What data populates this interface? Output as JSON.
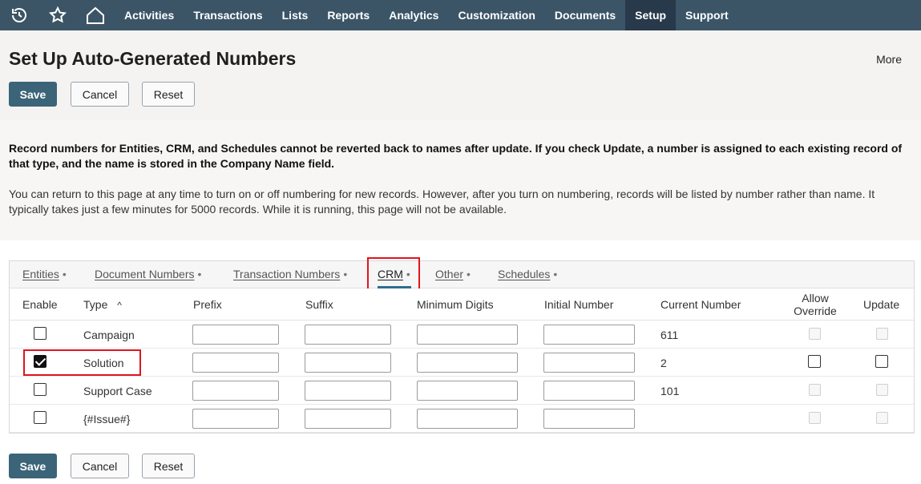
{
  "nav": {
    "icons": [
      "recent-history-icon",
      "star-icon",
      "home-icon"
    ],
    "items": [
      "Activities",
      "Transactions",
      "Lists",
      "Reports",
      "Analytics",
      "Customization",
      "Documents",
      "Setup",
      "Support"
    ],
    "active": "Setup"
  },
  "page": {
    "title": "Set Up Auto-Generated Numbers",
    "more": "More"
  },
  "buttons": {
    "save": "Save",
    "cancel": "Cancel",
    "reset": "Reset"
  },
  "info": {
    "warning": "Record numbers for Entities, CRM, and Schedules cannot be reverted back to names after update. If you check Update, a number is assigned to each existing record of that type, and the name is stored in the Company Name field.",
    "note": "You can return to this page at any time to turn on or off numbering for new records. However, after you turn on numbering, records will be listed by number rather than name. It typically takes just a few minutes for 5000 records. While it is running, this page will not be available."
  },
  "tabs": [
    "Entities",
    "Document Numbers",
    "Transaction Numbers",
    "CRM",
    "Other",
    "Schedules"
  ],
  "active_tab": "CRM",
  "table": {
    "headers": {
      "enable": "Enable",
      "type": "Type",
      "prefix": "Prefix",
      "suffix": "Suffix",
      "min_digits": "Minimum Digits",
      "initial": "Initial Number",
      "current": "Current Number",
      "allow_override_1": "Allow",
      "allow_override_2": "Override",
      "update": "Update"
    },
    "sort_indicator": "^",
    "rows": [
      {
        "type": "Campaign",
        "enabled": false,
        "current": "611",
        "override_enabled": false,
        "update_enabled": false
      },
      {
        "type": "Solution",
        "enabled": true,
        "current": "2",
        "override_enabled": true,
        "update_enabled": true
      },
      {
        "type": "Support Case",
        "enabled": false,
        "current": "101",
        "override_enabled": false,
        "update_enabled": false
      },
      {
        "type": "{#Issue#}",
        "enabled": false,
        "current": "",
        "override_enabled": false,
        "update_enabled": false
      }
    ]
  },
  "colors": {
    "nav_bg": "#3b5567",
    "nav_active_bg": "#27394a",
    "primary_button": "#3b6478",
    "highlight_box": "#e0141e",
    "tab_underline": "#2f6d8f"
  }
}
